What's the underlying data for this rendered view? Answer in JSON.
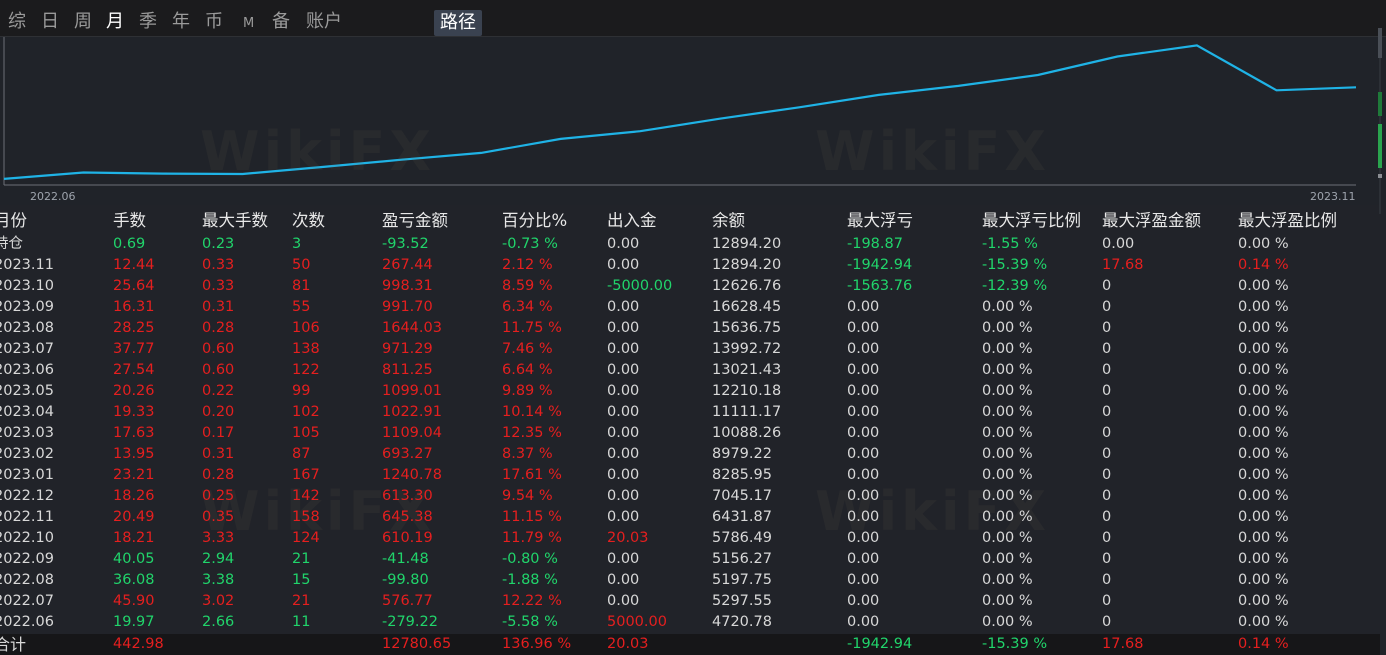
{
  "tabs": [
    {
      "label": "综",
      "name": "tab-summary",
      "active": false
    },
    {
      "label": "日",
      "name": "tab-day",
      "active": false
    },
    {
      "label": "周",
      "name": "tab-week",
      "active": false
    },
    {
      "label": "月",
      "name": "tab-month",
      "active": true
    },
    {
      "label": "季",
      "name": "tab-quarter",
      "active": false
    },
    {
      "label": "年",
      "name": "tab-year",
      "active": false
    },
    {
      "label": "币",
      "name": "tab-currency",
      "active": false
    },
    {
      "label": "M",
      "name": "tab-m",
      "active": false
    },
    {
      "label": "备",
      "name": "tab-backup",
      "active": false
    },
    {
      "label": "账户",
      "name": "tab-account",
      "active": false
    },
    {
      "label": "路径",
      "name": "tab-path",
      "active": false
    }
  ],
  "chart_data": {
    "type": "line",
    "title": "",
    "x_tick_labels": [
      "2022.06",
      "2023.11"
    ],
    "x": [
      "2022.06",
      "2022.07",
      "2022.08",
      "2022.09",
      "2022.10",
      "2022.11",
      "2022.12",
      "2023.01",
      "2023.02",
      "2023.03",
      "2023.04",
      "2023.05",
      "2023.06",
      "2023.07",
      "2023.08",
      "2023.09",
      "2023.10",
      "2023.11"
    ],
    "series": [
      {
        "values": [
          4720.78,
          5297.55,
          5197.75,
          5156.27,
          5786.49,
          6431.87,
          7045.17,
          8285.95,
          8979.22,
          10088.26,
          11111.17,
          12210.18,
          13021.43,
          13992.72,
          15636.75,
          16628.45,
          12626.76,
          12894.2
        ]
      }
    ],
    "line_color": "#1fb3e6",
    "grid": false
  },
  "table": {
    "headers": [
      "月份",
      "手数",
      "最大手数",
      "次数",
      "盈亏金额",
      "百分比%",
      "出入金",
      "余额",
      "最大浮亏",
      "最大浮亏比例",
      "最大浮盈金额",
      "最大浮盈比例"
    ],
    "rows": [
      {
        "cells": [
          "持仓",
          "0.69",
          "0.23",
          "3",
          "-93.52",
          "-0.73 %",
          "0.00",
          "12894.20",
          "-198.87",
          "-1.55 %",
          "0.00",
          "0.00 %"
        ],
        "colors": [
          "w",
          "g",
          "g",
          "g",
          "g",
          "g",
          "w",
          "w",
          "g",
          "g",
          "w",
          "w"
        ]
      },
      {
        "cells": [
          "2023.11",
          "12.44",
          "0.33",
          "50",
          "267.44",
          "2.12 %",
          "0.00",
          "12894.20",
          "-1942.94",
          "-15.39 %",
          "17.68",
          "0.14 %"
        ],
        "colors": [
          "w",
          "r",
          "r",
          "r",
          "r",
          "r",
          "w",
          "w",
          "g",
          "g",
          "r",
          "r"
        ]
      },
      {
        "cells": [
          "2023.10",
          "25.64",
          "0.33",
          "81",
          "998.31",
          "8.59 %",
          "-5000.00",
          "12626.76",
          "-1563.76",
          "-12.39 %",
          "0",
          "0.00 %"
        ],
        "colors": [
          "w",
          "r",
          "r",
          "r",
          "r",
          "r",
          "g",
          "w",
          "g",
          "g",
          "w",
          "w"
        ]
      },
      {
        "cells": [
          "2023.09",
          "16.31",
          "0.31",
          "55",
          "991.70",
          "6.34 %",
          "0.00",
          "16628.45",
          "0.00",
          "0.00 %",
          "0",
          "0.00 %"
        ],
        "colors": [
          "w",
          "r",
          "r",
          "r",
          "r",
          "r",
          "w",
          "w",
          "w",
          "w",
          "w",
          "w"
        ]
      },
      {
        "cells": [
          "2023.08",
          "28.25",
          "0.28",
          "106",
          "1644.03",
          "11.75 %",
          "0.00",
          "15636.75",
          "0.00",
          "0.00 %",
          "0",
          "0.00 %"
        ],
        "colors": [
          "w",
          "r",
          "r",
          "r",
          "r",
          "r",
          "w",
          "w",
          "w",
          "w",
          "w",
          "w"
        ]
      },
      {
        "cells": [
          "2023.07",
          "37.77",
          "0.60",
          "138",
          "971.29",
          "7.46 %",
          "0.00",
          "13992.72",
          "0.00",
          "0.00 %",
          "0",
          "0.00 %"
        ],
        "colors": [
          "w",
          "r",
          "r",
          "r",
          "r",
          "r",
          "w",
          "w",
          "w",
          "w",
          "w",
          "w"
        ]
      },
      {
        "cells": [
          "2023.06",
          "27.54",
          "0.60",
          "122",
          "811.25",
          "6.64 %",
          "0.00",
          "13021.43",
          "0.00",
          "0.00 %",
          "0",
          "0.00 %"
        ],
        "colors": [
          "w",
          "r",
          "r",
          "r",
          "r",
          "r",
          "w",
          "w",
          "w",
          "w",
          "w",
          "w"
        ]
      },
      {
        "cells": [
          "2023.05",
          "20.26",
          "0.22",
          "99",
          "1099.01",
          "9.89 %",
          "0.00",
          "12210.18",
          "0.00",
          "0.00 %",
          "0",
          "0.00 %"
        ],
        "colors": [
          "w",
          "r",
          "r",
          "r",
          "r",
          "r",
          "w",
          "w",
          "w",
          "w",
          "w",
          "w"
        ]
      },
      {
        "cells": [
          "2023.04",
          "19.33",
          "0.20",
          "102",
          "1022.91",
          "10.14 %",
          "0.00",
          "11111.17",
          "0.00",
          "0.00 %",
          "0",
          "0.00 %"
        ],
        "colors": [
          "w",
          "r",
          "r",
          "r",
          "r",
          "r",
          "w",
          "w",
          "w",
          "w",
          "w",
          "w"
        ]
      },
      {
        "cells": [
          "2023.03",
          "17.63",
          "0.17",
          "105",
          "1109.04",
          "12.35 %",
          "0.00",
          "10088.26",
          "0.00",
          "0.00 %",
          "0",
          "0.00 %"
        ],
        "colors": [
          "w",
          "r",
          "r",
          "r",
          "r",
          "r",
          "w",
          "w",
          "w",
          "w",
          "w",
          "w"
        ]
      },
      {
        "cells": [
          "2023.02",
          "13.95",
          "0.31",
          "87",
          "693.27",
          "8.37 %",
          "0.00",
          "8979.22",
          "0.00",
          "0.00 %",
          "0",
          "0.00 %"
        ],
        "colors": [
          "w",
          "r",
          "r",
          "r",
          "r",
          "r",
          "w",
          "w",
          "w",
          "w",
          "w",
          "w"
        ]
      },
      {
        "cells": [
          "2023.01",
          "23.21",
          "0.28",
          "167",
          "1240.78",
          "17.61 %",
          "0.00",
          "8285.95",
          "0.00",
          "0.00 %",
          "0",
          "0.00 %"
        ],
        "colors": [
          "w",
          "r",
          "r",
          "r",
          "r",
          "r",
          "w",
          "w",
          "w",
          "w",
          "w",
          "w"
        ]
      },
      {
        "cells": [
          "2022.12",
          "18.26",
          "0.25",
          "142",
          "613.30",
          "9.54 %",
          "0.00",
          "7045.17",
          "0.00",
          "0.00 %",
          "0",
          "0.00 %"
        ],
        "colors": [
          "w",
          "r",
          "r",
          "r",
          "r",
          "r",
          "w",
          "w",
          "w",
          "w",
          "w",
          "w"
        ]
      },
      {
        "cells": [
          "2022.11",
          "20.49",
          "0.35",
          "158",
          "645.38",
          "11.15 %",
          "0.00",
          "6431.87",
          "0.00",
          "0.00 %",
          "0",
          "0.00 %"
        ],
        "colors": [
          "w",
          "r",
          "r",
          "r",
          "r",
          "r",
          "w",
          "w",
          "w",
          "w",
          "w",
          "w"
        ]
      },
      {
        "cells": [
          "2022.10",
          "18.21",
          "3.33",
          "124",
          "610.19",
          "11.79 %",
          "20.03",
          "5786.49",
          "0.00",
          "0.00 %",
          "0",
          "0.00 %"
        ],
        "colors": [
          "w",
          "r",
          "r",
          "r",
          "r",
          "r",
          "r",
          "w",
          "w",
          "w",
          "w",
          "w"
        ]
      },
      {
        "cells": [
          "2022.09",
          "40.05",
          "2.94",
          "21",
          "-41.48",
          "-0.80 %",
          "0.00",
          "5156.27",
          "0.00",
          "0.00 %",
          "0",
          "0.00 %"
        ],
        "colors": [
          "w",
          "g",
          "g",
          "g",
          "g",
          "g",
          "w",
          "w",
          "w",
          "w",
          "w",
          "w"
        ]
      },
      {
        "cells": [
          "2022.08",
          "36.08",
          "3.38",
          "15",
          "-99.80",
          "-1.88 %",
          "0.00",
          "5197.75",
          "0.00",
          "0.00 %",
          "0",
          "0.00 %"
        ],
        "colors": [
          "w",
          "g",
          "g",
          "g",
          "g",
          "g",
          "w",
          "w",
          "w",
          "w",
          "w",
          "w"
        ]
      },
      {
        "cells": [
          "2022.07",
          "45.90",
          "3.02",
          "21",
          "576.77",
          "12.22 %",
          "0.00",
          "5297.55",
          "0.00",
          "0.00 %",
          "0",
          "0.00 %"
        ],
        "colors": [
          "w",
          "r",
          "r",
          "r",
          "r",
          "r",
          "w",
          "w",
          "w",
          "w",
          "w",
          "w"
        ]
      },
      {
        "cells": [
          "2022.06",
          "19.97",
          "2.66",
          "11",
          "-279.22",
          "-5.58 %",
          "5000.00",
          "4720.78",
          "0.00",
          "0.00 %",
          "0",
          "0.00 %"
        ],
        "colors": [
          "w",
          "g",
          "g",
          "g",
          "g",
          "g",
          "r",
          "w",
          "w",
          "w",
          "w",
          "w"
        ]
      }
    ],
    "total": {
      "cells": [
        "合计",
        "442.98",
        "",
        "",
        "12780.65",
        "136.96 %",
        "20.03",
        "",
        "-1942.94",
        "-15.39 %",
        "17.68",
        "0.14 %"
      ],
      "colors": [
        "w",
        "r",
        "r",
        "r",
        "r",
        "r",
        "r",
        "w",
        "g",
        "g",
        "r",
        "r"
      ]
    }
  },
  "colors": {
    "positive": "#e51f1f",
    "negative": "#21d46b",
    "line": "#1fb3e6",
    "background": "#212329"
  },
  "watermark": "WikiFX"
}
